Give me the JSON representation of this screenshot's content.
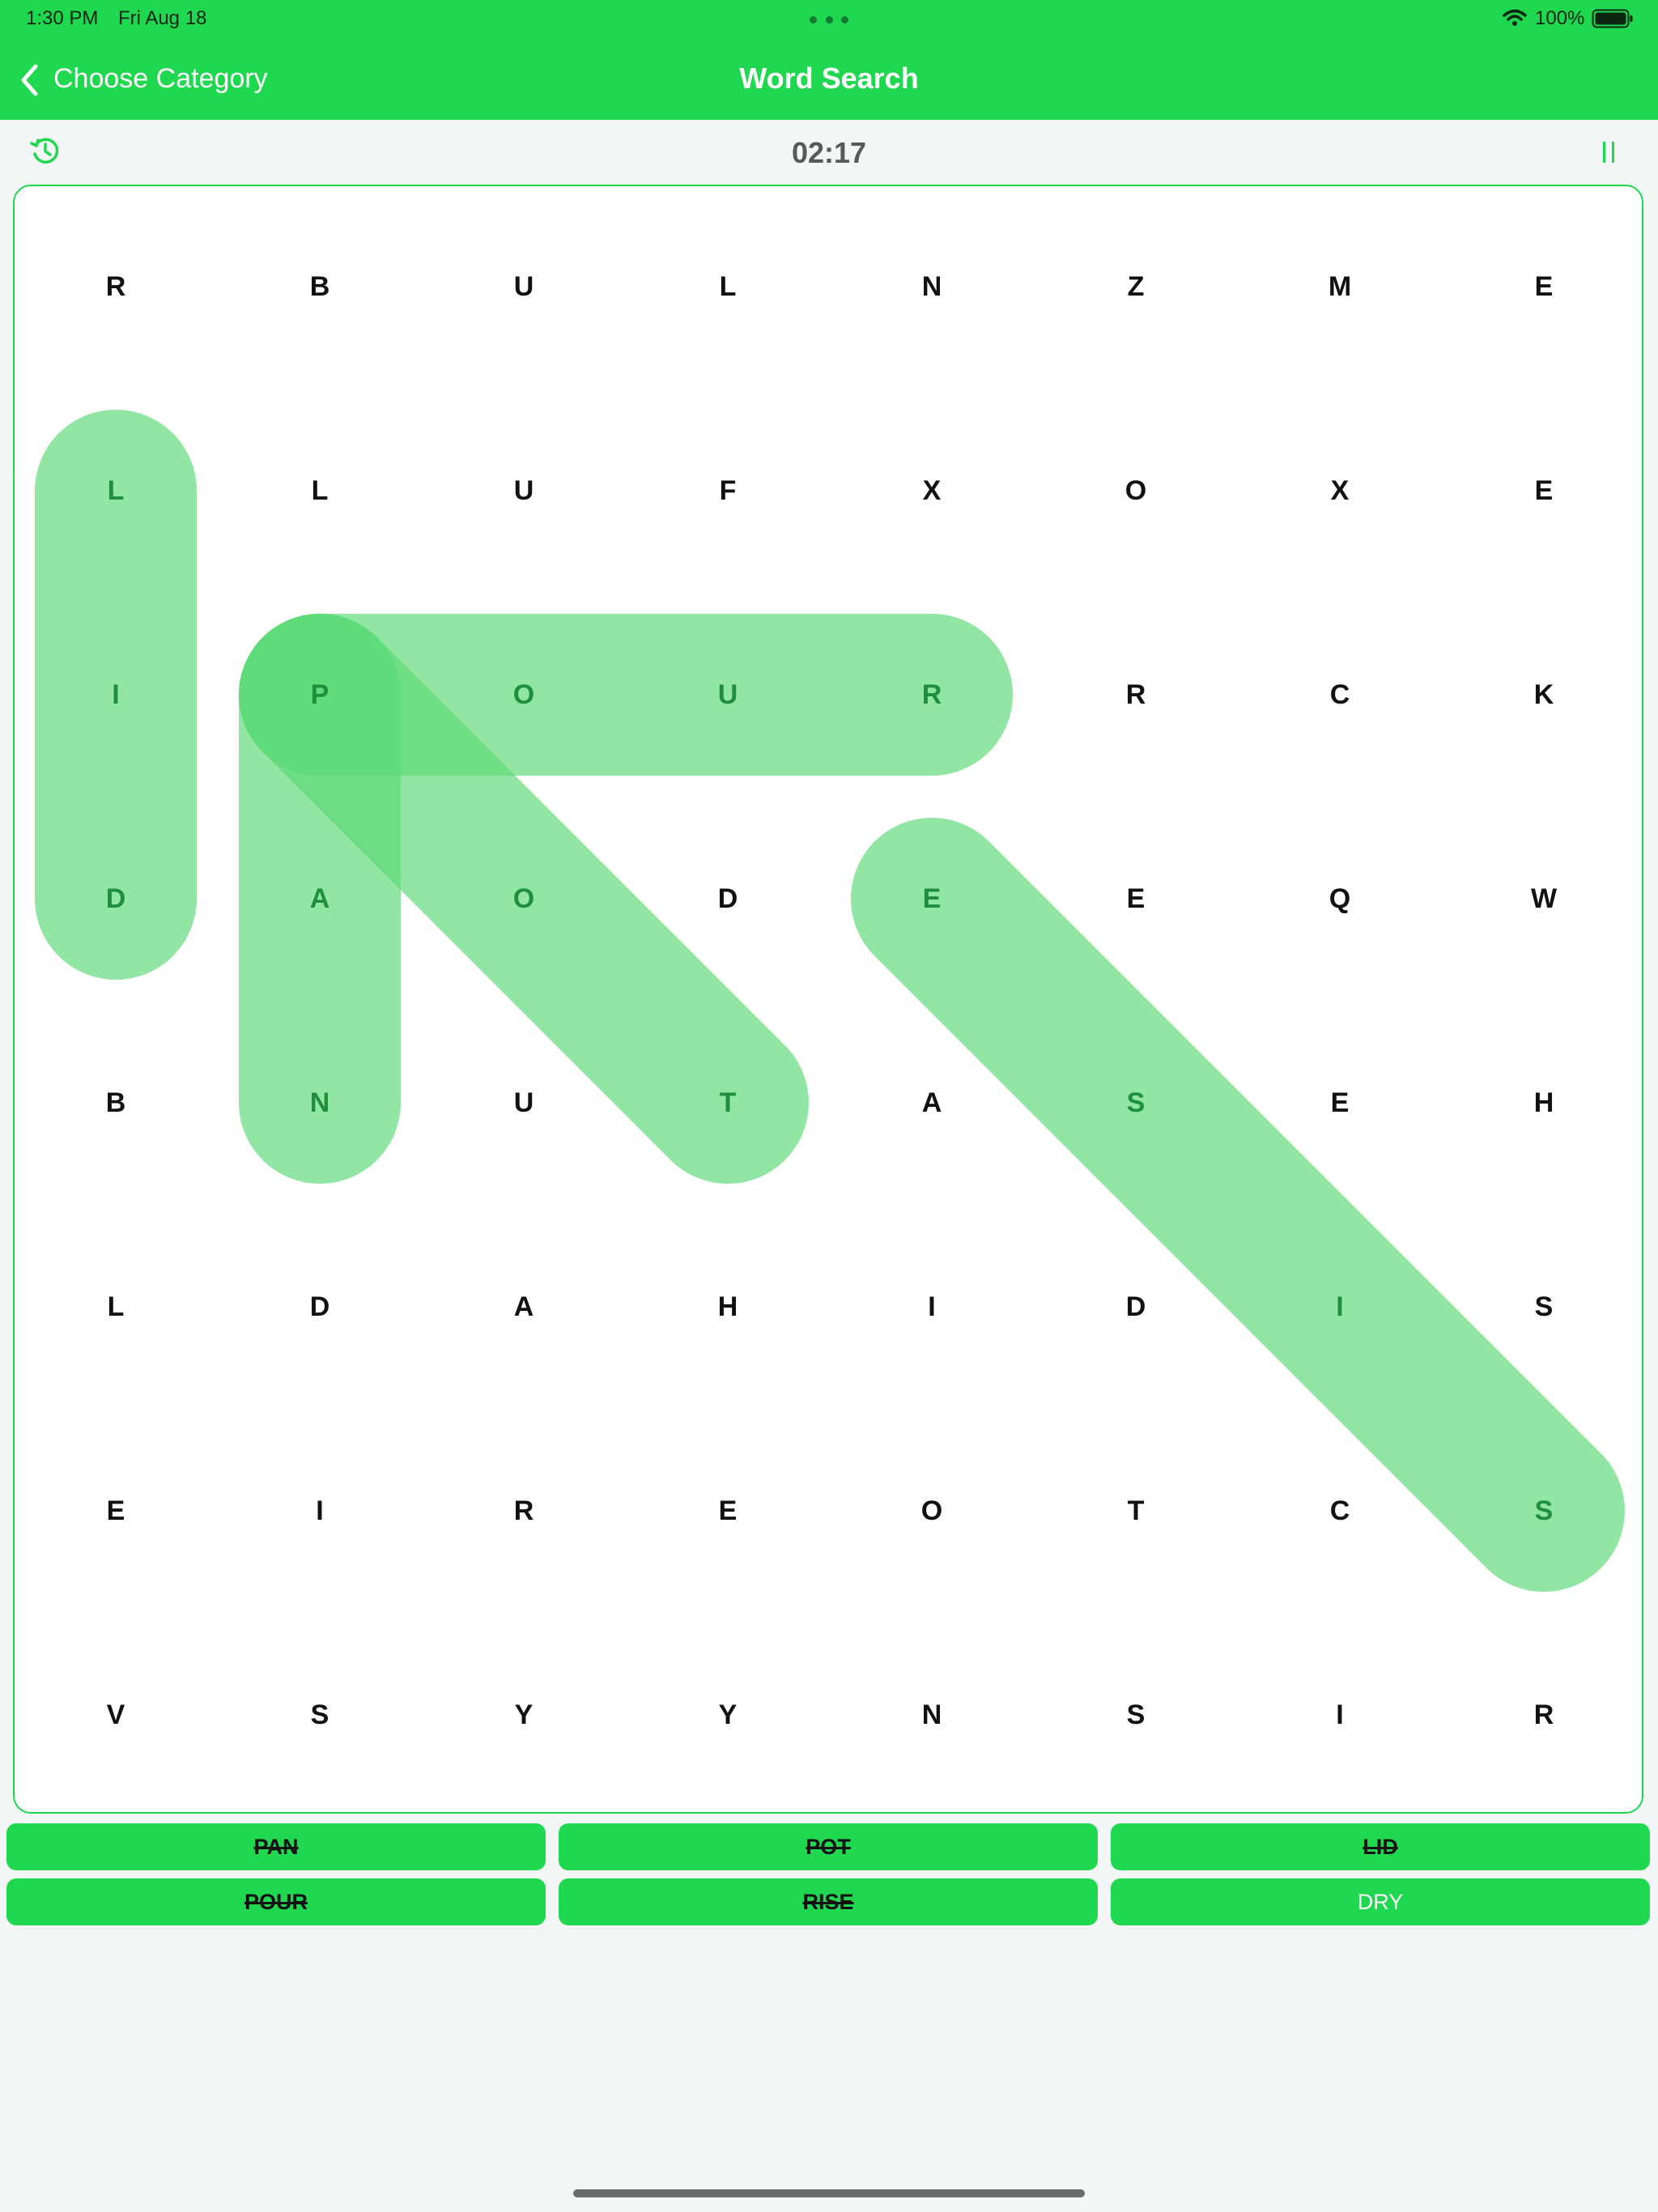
{
  "status_bar": {
    "time": "1:30 PM",
    "date": "Fri Aug 18",
    "battery": "100%"
  },
  "nav": {
    "back_label": "Choose Category",
    "title": "Word Search"
  },
  "toolbar": {
    "timer": "02:17"
  },
  "grid": {
    "rows": [
      [
        "R",
        "B",
        "U",
        "L",
        "N",
        "Z",
        "M",
        "E"
      ],
      [
        "L",
        "L",
        "U",
        "F",
        "X",
        "O",
        "X",
        "E"
      ],
      [
        "I",
        "P",
        "O",
        "U",
        "R",
        "R",
        "C",
        "K"
      ],
      [
        "D",
        "A",
        "O",
        "D",
        "E",
        "E",
        "Q",
        "W"
      ],
      [
        "B",
        "N",
        "U",
        "T",
        "A",
        "S",
        "E",
        "H"
      ],
      [
        "L",
        "D",
        "A",
        "H",
        "I",
        "D",
        "I",
        "S"
      ],
      [
        "E",
        "I",
        "R",
        "E",
        "O",
        "T",
        "C",
        "S"
      ],
      [
        "V",
        "S",
        "Y",
        "Y",
        "N",
        "S",
        "I",
        "R"
      ]
    ],
    "found_paths": [
      {
        "word": "LID",
        "from": [
          1,
          0
        ],
        "to": [
          3,
          0
        ]
      },
      {
        "word": "PAN",
        "from": [
          2,
          1
        ],
        "to": [
          4,
          1
        ]
      },
      {
        "word": "POUR",
        "from": [
          2,
          1
        ],
        "to": [
          2,
          4
        ]
      },
      {
        "word": "POT",
        "from": [
          2,
          1
        ],
        "to": [
          4,
          3
        ]
      },
      {
        "word": "RISE",
        "from": [
          6,
          7
        ],
        "to": [
          3,
          4
        ]
      }
    ]
  },
  "words": [
    {
      "label": "PAN",
      "found": true
    },
    {
      "label": "POT",
      "found": true
    },
    {
      "label": "LID",
      "found": true
    },
    {
      "label": "POUR",
      "found": true
    },
    {
      "label": "RISE",
      "found": true
    },
    {
      "label": "DRY",
      "found": false
    }
  ],
  "colors": {
    "accent": "#20d84f",
    "highlight": "#5ad974",
    "found_letter": "#1f8f3c",
    "letter": "#111111"
  }
}
